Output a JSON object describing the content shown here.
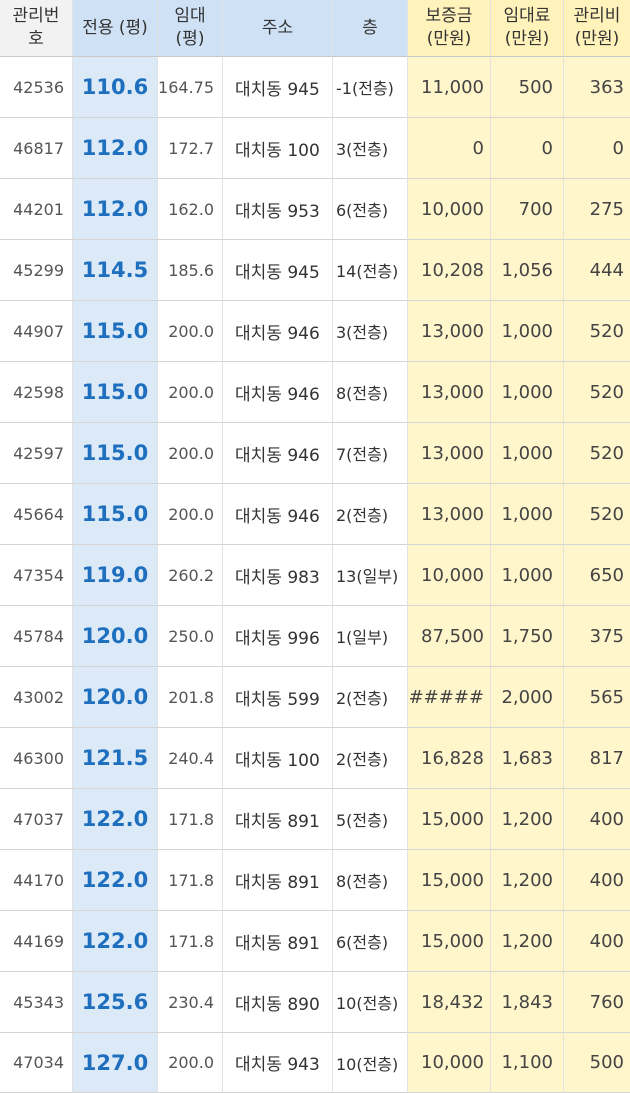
{
  "headers": {
    "id": [
      "관리번",
      "호"
    ],
    "area": [
      "전용 (평)"
    ],
    "rent_area": [
      "임대",
      "(평)"
    ],
    "address": [
      "주소"
    ],
    "floor": [
      "층"
    ],
    "deposit": [
      "보증금",
      "(만원)"
    ],
    "fee": [
      "임대료",
      "(만원)"
    ],
    "mgmt": [
      "관리비",
      "(만원)"
    ]
  },
  "rows": [
    {
      "id": "42536",
      "area": "110.6",
      "rent_area": "164.75",
      "address": "대치동 945",
      "floor": "-1(전층)",
      "deposit": "11,000",
      "fee": "500",
      "mgmt": "363"
    },
    {
      "id": "46817",
      "area": "112.0",
      "rent_area": "172.7",
      "address": "대치동 100",
      "floor": "3(전층)",
      "deposit": "0",
      "fee": "0",
      "mgmt": "0"
    },
    {
      "id": "44201",
      "area": "112.0",
      "rent_area": "162.0",
      "address": "대치동 953",
      "floor": "6(전층)",
      "deposit": "10,000",
      "fee": "700",
      "mgmt": "275"
    },
    {
      "id": "45299",
      "area": "114.5",
      "rent_area": "185.6",
      "address": "대치동 945",
      "floor": "14(전층)",
      "deposit": "10,208",
      "fee": "1,056",
      "mgmt": "444"
    },
    {
      "id": "44907",
      "area": "115.0",
      "rent_area": "200.0",
      "address": "대치동 946",
      "floor": "3(전층)",
      "deposit": "13,000",
      "fee": "1,000",
      "mgmt": "520"
    },
    {
      "id": "42598",
      "area": "115.0",
      "rent_area": "200.0",
      "address": "대치동 946",
      "floor": "8(전층)",
      "deposit": "13,000",
      "fee": "1,000",
      "mgmt": "520"
    },
    {
      "id": "42597",
      "area": "115.0",
      "rent_area": "200.0",
      "address": "대치동 946",
      "floor": "7(전층)",
      "deposit": "13,000",
      "fee": "1,000",
      "mgmt": "520"
    },
    {
      "id": "45664",
      "area": "115.0",
      "rent_area": "200.0",
      "address": "대치동 946",
      "floor": "2(전층)",
      "deposit": "13,000",
      "fee": "1,000",
      "mgmt": "520"
    },
    {
      "id": "47354",
      "area": "119.0",
      "rent_area": "260.2",
      "address": "대치동   983",
      "floor": "13(일부)",
      "deposit": "10,000",
      "fee": "1,000",
      "mgmt": "650"
    },
    {
      "id": "45784",
      "area": "120.0",
      "rent_area": "250.0",
      "address": "대치동 996",
      "floor": "1(일부)",
      "deposit": "87,500",
      "fee": "1,750",
      "mgmt": "375"
    },
    {
      "id": "43002",
      "area": "120.0",
      "rent_area": "201.8",
      "address": "대치동 599",
      "floor": "2(전층)",
      "deposit": "######",
      "fee": "2,000",
      "mgmt": "565"
    },
    {
      "id": "46300",
      "area": "121.5",
      "rent_area": "240.4",
      "address": "대치동 100",
      "floor": "2(전층)",
      "deposit": "16,828",
      "fee": "1,683",
      "mgmt": "817"
    },
    {
      "id": "47037",
      "area": "122.0",
      "rent_area": "171.8",
      "address": "대치동 891",
      "floor": "5(전층)",
      "deposit": "15,000",
      "fee": "1,200",
      "mgmt": "400"
    },
    {
      "id": "44170",
      "area": "122.0",
      "rent_area": "171.8",
      "address": "대치동 891",
      "floor": "8(전층)",
      "deposit": "15,000",
      "fee": "1,200",
      "mgmt": "400"
    },
    {
      "id": "44169",
      "area": "122.0",
      "rent_area": "171.8",
      "address": "대치동 891",
      "floor": "6(전층)",
      "deposit": "15,000",
      "fee": "1,200",
      "mgmt": "400"
    },
    {
      "id": "45343",
      "area": "125.6",
      "rent_area": "230.4",
      "address": "대치동 890",
      "floor": "10(전층)",
      "deposit": "18,432",
      "fee": "1,843",
      "mgmt": "760"
    },
    {
      "id": "47034",
      "area": "127.0",
      "rent_area": "200.0",
      "address": "대치동 943",
      "floor": "10(전층)",
      "deposit": "10,000",
      "fee": "1,100",
      "mgmt": "500"
    }
  ],
  "colors": {
    "area_text": "#1f6fbf",
    "area_column_bg": "#dceaf8",
    "money_columns_bg": "#fff6cc"
  }
}
